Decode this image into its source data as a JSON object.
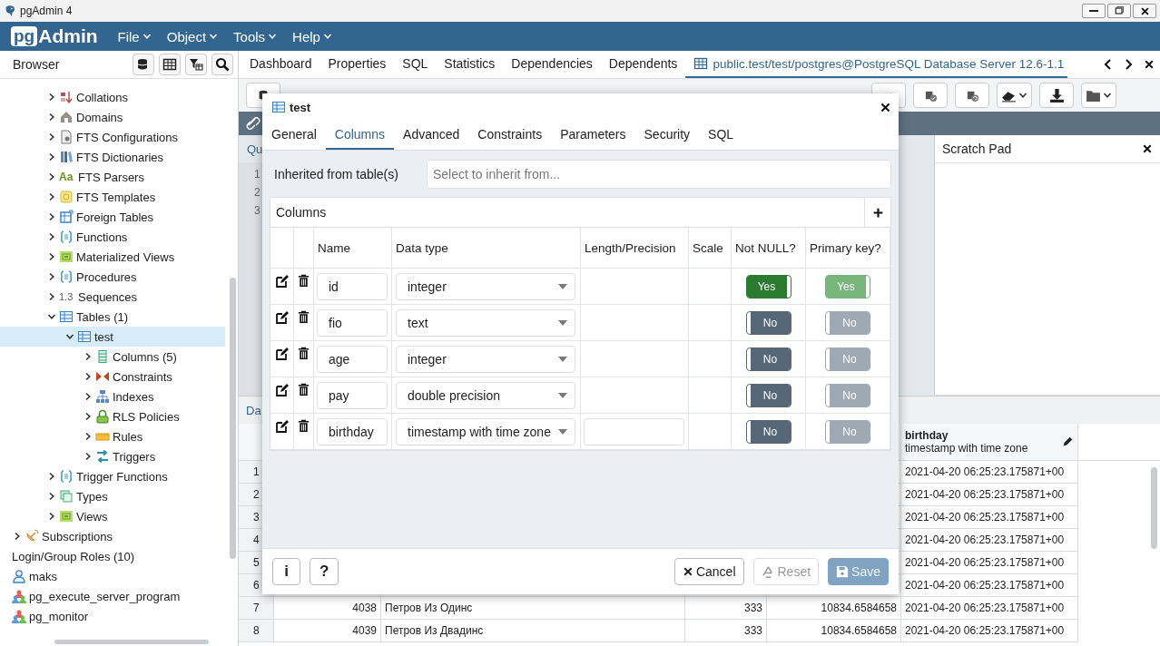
{
  "window": {
    "title": "pgAdmin 4"
  },
  "menubar": {
    "logo": {
      "boxed": "pg",
      "text": "Admin"
    },
    "menus": [
      {
        "label": "File"
      },
      {
        "label": "Object"
      },
      {
        "label": "Tools"
      },
      {
        "label": "Help"
      }
    ]
  },
  "browser": {
    "title": "Browser",
    "schema_items": [
      {
        "label": "Collations",
        "kind": "collation",
        "expanded": false,
        "selected": false
      },
      {
        "label": "Domains",
        "kind": "domain",
        "expanded": false,
        "selected": false
      },
      {
        "label": "FTS Configurations",
        "kind": "config",
        "expanded": false,
        "selected": false
      },
      {
        "label": "FTS Dictionaries",
        "kind": "dictionary",
        "expanded": false,
        "selected": false
      },
      {
        "label": "FTS Parsers",
        "kind": "text",
        "badge": "Aa",
        "expanded": false,
        "selected": false
      },
      {
        "label": "FTS Templates",
        "kind": "template",
        "expanded": false,
        "selected": false
      },
      {
        "label": "Foreign Tables",
        "kind": "foreign",
        "expanded": false,
        "selected": false
      },
      {
        "label": "Functions",
        "kind": "function",
        "expanded": false,
        "selected": false
      },
      {
        "label": "Materialized Views",
        "kind": "view",
        "expanded": false,
        "selected": false
      },
      {
        "label": "Procedures",
        "kind": "function",
        "expanded": false,
        "selected": false
      },
      {
        "label": "Sequences",
        "kind": "text",
        "badge": "1.3",
        "expanded": false,
        "selected": false
      },
      {
        "label": "Tables (1)",
        "kind": "table",
        "expanded": true,
        "selected": false,
        "children": [
          {
            "label": "test",
            "kind": "table",
            "expanded": true,
            "selected": true,
            "children": [
              {
                "label": "Columns (5)",
                "kind": "columns",
                "expanded": false,
                "selected": false
              },
              {
                "label": "Constraints",
                "kind": "constraint",
                "expanded": false,
                "selected": false
              },
              {
                "label": "Indexes",
                "kind": "index",
                "expanded": false,
                "selected": false
              },
              {
                "label": "RLS Policies",
                "kind": "lock",
                "expanded": false,
                "selected": false
              },
              {
                "label": "Rules",
                "kind": "rule",
                "expanded": false,
                "selected": false
              },
              {
                "label": "Triggers",
                "kind": "trigger",
                "expanded": false,
                "selected": false
              }
            ]
          }
        ]
      },
      {
        "label": "Trigger Functions",
        "kind": "function",
        "expanded": false,
        "selected": false
      },
      {
        "label": "Types",
        "kind": "type",
        "expanded": false,
        "selected": false
      },
      {
        "label": "Views",
        "kind": "view",
        "expanded": false,
        "selected": false
      }
    ],
    "database_items": [
      {
        "label": "Subscriptions",
        "kind": "subscription",
        "expanded": false,
        "selected": false
      }
    ],
    "role_items": [
      {
        "label": "Login/Group Roles (10)",
        "kind": "none",
        "selected": false
      },
      {
        "label": "maks",
        "kind": "user",
        "selected": false
      },
      {
        "label": "pg_execute_server_program",
        "kind": "group",
        "selected": false
      },
      {
        "label": "pg_monitor",
        "kind": "group",
        "selected": false
      }
    ]
  },
  "tabs": [
    {
      "label": "Dashboard",
      "selected": false
    },
    {
      "label": "Properties",
      "selected": false
    },
    {
      "label": "SQL",
      "selected": false
    },
    {
      "label": "Statistics",
      "selected": false
    },
    {
      "label": "Dependencies",
      "selected": false
    },
    {
      "label": "Dependents",
      "selected": false
    },
    {
      "label": "public.test/test/postgres@PostgreSQL Database Server 12.6-1.1",
      "selected": true
    }
  ],
  "query_tool": {
    "editor_tab": "Qu",
    "line_numbers": [
      "1",
      "2",
      "3"
    ],
    "scratch_pad": {
      "title": "Scratch Pad"
    },
    "output_tab": "Da",
    "grid": {
      "birthday_header": {
        "name": "birthday",
        "type": "timestamp with time zone"
      },
      "rows": [
        {
          "number": "1",
          "birthday": "2021-04-20 06:25:23.175871+00"
        },
        {
          "number": "2",
          "birthday": "2021-04-20 06:25:23.175871+00"
        },
        {
          "number": "3",
          "birthday": "2021-04-20 06:25:23.175871+00"
        },
        {
          "number": "4",
          "birthday": "2021-04-20 06:25:23.175871+00"
        },
        {
          "number": "5",
          "birthday": "2021-04-20 06:25:23.175871+00"
        },
        {
          "number": "6",
          "birthday": "2021-04-20 06:25:23.175871+00"
        },
        {
          "number": "7",
          "column_1": "4038",
          "column_2": "Петров Из Одинс",
          "column_3": "333",
          "column_4": "10834.6584658",
          "birthday": "2021-04-20 06:25:23.175871+00"
        },
        {
          "number": "8",
          "column_1": "4039",
          "column_2": "Петров Из Двадинс",
          "column_3": "333",
          "column_4": "10834.6584658",
          "birthday": "2021-04-20 06:25:23.175871+00"
        }
      ]
    }
  },
  "dialog": {
    "title": "test",
    "tabs": [
      {
        "label": "General",
        "selected": false
      },
      {
        "label": "Columns",
        "selected": true
      },
      {
        "label": "Advanced",
        "selected": false
      },
      {
        "label": "Constraints",
        "selected": false
      },
      {
        "label": "Parameters",
        "selected": false
      },
      {
        "label": "Security",
        "selected": false
      },
      {
        "label": "SQL",
        "selected": false
      }
    ],
    "inherited": {
      "label": "Inherited from table(s)",
      "placeholder": "Select to inherit from..."
    },
    "columns_title": "Columns",
    "headers": [
      "Name",
      "Data type",
      "Length/Precision",
      "Scale",
      "Not NULL?",
      "Primary key?"
    ],
    "rows": [
      {
        "name": "id",
        "data_type": "integer",
        "length_field": false,
        "not_null": {
          "on": true,
          "label": "Yes",
          "disabled": false
        },
        "primary_key": {
          "on": true,
          "label": "Yes",
          "disabled": true
        }
      },
      {
        "name": "fio",
        "data_type": "text",
        "length_field": false,
        "not_null": {
          "on": false,
          "label": "No",
          "disabled": false
        },
        "primary_key": {
          "on": false,
          "label": "No",
          "disabled": true
        }
      },
      {
        "name": "age",
        "data_type": "integer",
        "length_field": false,
        "not_null": {
          "on": false,
          "label": "No",
          "disabled": false
        },
        "primary_key": {
          "on": false,
          "label": "No",
          "disabled": true
        }
      },
      {
        "name": "pay",
        "data_type": "double precision",
        "length_field": false,
        "not_null": {
          "on": false,
          "label": "No",
          "disabled": false
        },
        "primary_key": {
          "on": false,
          "label": "No",
          "disabled": true
        }
      },
      {
        "name": "birthday",
        "data_type": "timestamp with time zone",
        "length_field": true,
        "not_null": {
          "on": false,
          "label": "No",
          "disabled": false
        },
        "primary_key": {
          "on": false,
          "label": "No",
          "disabled": true
        }
      }
    ],
    "footer": {
      "info": "i",
      "help": "?",
      "cancel": {
        "label": "Cancel",
        "disabled": false
      },
      "reset": {
        "label": "Reset",
        "disabled": true
      },
      "save": {
        "label": "Save",
        "disabled": true
      }
    }
  }
}
